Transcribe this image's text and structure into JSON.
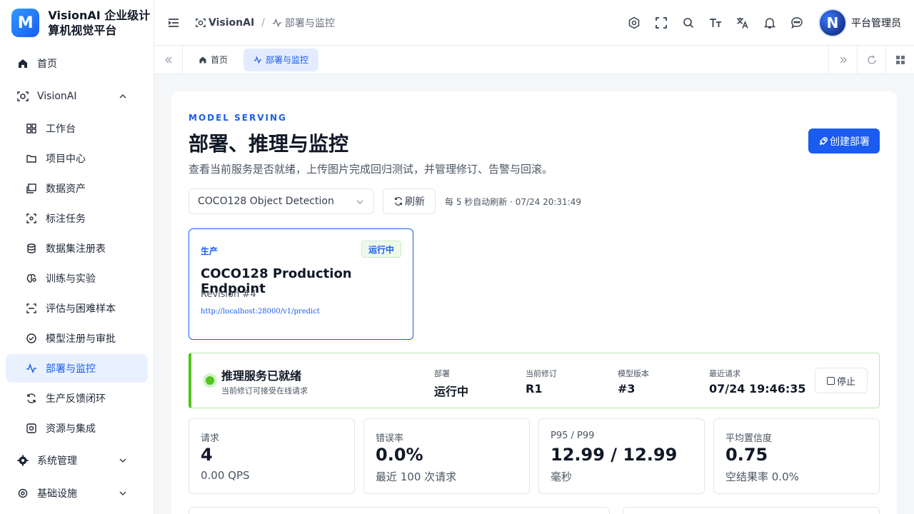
{
  "app": {
    "logo_letter": "M",
    "title": "VisionAI 企业级计算机视觉平台"
  },
  "sidebar": {
    "home": "首页",
    "visionai": "VisionAI",
    "items": [
      "工作台",
      "项目中心",
      "数据资产",
      "标注任务",
      "数据集注册表",
      "训练与实验",
      "评估与困难样本",
      "模型注册与审批",
      "部署与监控",
      "生产反馈闭环",
      "资源与集成"
    ],
    "system": "系统管理",
    "infra": "基础设施"
  },
  "header": {
    "crumb_root": "VisionAI",
    "crumb_sep": "/",
    "crumb_current": "部署与监控",
    "avatar_letter": "N",
    "user_name": "平台管理员"
  },
  "tabs": [
    {
      "label": "首页"
    },
    {
      "label": "部署与监控"
    }
  ],
  "page": {
    "eyebrow": "MODEL SERVING",
    "title": "部署、推理与监控",
    "description": "查看当前服务是否就绪，上传图片完成回归测试，并管理修订、告警与回滚。",
    "create_label": "创建部署",
    "select_value": "COCO128 Object Detection",
    "refresh_label": "刷新",
    "auto_refresh": "每 5 秒自动刷新 · 07/24 20:31:49"
  },
  "endpoint": {
    "env": "生产",
    "status": "运行中",
    "name": "COCO128 Production Endpoint",
    "revision": "Revision #4",
    "url": "http://localhost:28000/v1/predict"
  },
  "ready": {
    "title": "推理服务已就绪",
    "subtitle": "当前修订可接受在线请求",
    "fields": [
      {
        "k": "部署",
        "v": "运行中"
      },
      {
        "k": "当前修订",
        "v": "R1"
      },
      {
        "k": "模型版本",
        "v": "#3"
      },
      {
        "k": "最近请求",
        "v": "07/24 19:46:35"
      }
    ],
    "stop_label": "停止"
  },
  "metrics": [
    {
      "label": "请求",
      "value": "4",
      "sub": "0.00 QPS"
    },
    {
      "label": "错误率",
      "value": "0.0%",
      "sub": "最近 100 次请求"
    },
    {
      "label": "P95 / P99",
      "value": "12.99 / 12.99",
      "sub": "毫秒"
    },
    {
      "label": "平均置信度",
      "value": "0.75",
      "sub": "空结果率 0.0%"
    }
  ],
  "colors": {
    "primary": "#1a5cf0",
    "success": "#52c41a",
    "active_bg": "#e9f1ff"
  }
}
